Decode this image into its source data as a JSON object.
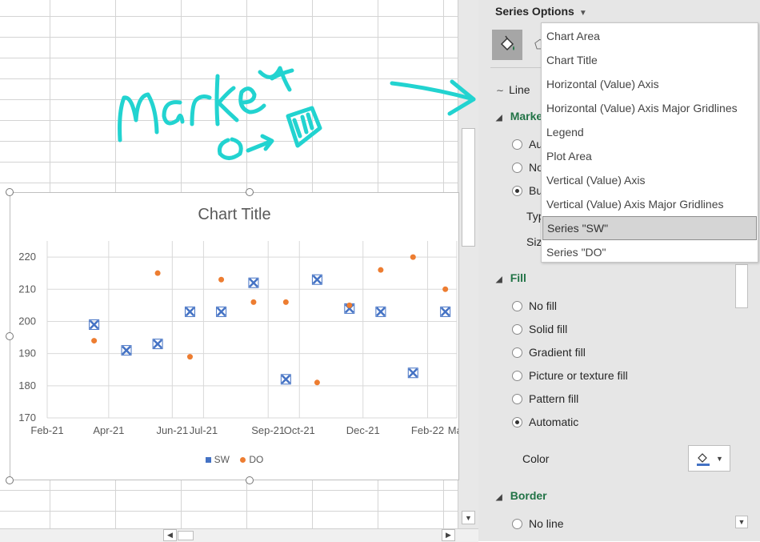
{
  "sheet": {},
  "chart": {
    "title": "Chart Title",
    "legend": [
      "SW",
      "DO"
    ]
  },
  "chart_data": {
    "type": "scatter",
    "title": "Chart Title",
    "x_tick_labels": [
      "Feb-21",
      "Apr-21",
      "Jun-21",
      "Jul-21",
      "Sep-21",
      "Oct-21",
      "Dec-21",
      "Feb-22",
      "Mar"
    ],
    "y_ticks": [
      170,
      180,
      190,
      200,
      210,
      220
    ],
    "ylim": [
      170,
      225
    ],
    "grid": true,
    "legend_position": "bottom",
    "series": [
      {
        "name": "SW",
        "marker": "cross-x",
        "color": "#4472c4",
        "points": [
          {
            "x": "2021-03-18",
            "y": 199
          },
          {
            "x": "2021-04-18",
            "y": 191
          },
          {
            "x": "2021-05-18",
            "y": 193
          },
          {
            "x": "2021-06-18",
            "y": 203
          },
          {
            "x": "2021-07-18",
            "y": 203
          },
          {
            "x": "2021-08-18",
            "y": 212
          },
          {
            "x": "2021-09-18",
            "y": 182
          },
          {
            "x": "2021-10-18",
            "y": 213
          },
          {
            "x": "2021-11-18",
            "y": 204
          },
          {
            "x": "2021-12-18",
            "y": 203
          },
          {
            "x": "2022-01-18",
            "y": 184
          },
          {
            "x": "2022-02-18",
            "y": 203
          }
        ]
      },
      {
        "name": "DO",
        "marker": "circle",
        "color": "#ed7d31",
        "points": [
          {
            "x": "2021-03-18",
            "y": 194
          },
          {
            "x": "2021-05-18",
            "y": 215
          },
          {
            "x": "2021-06-18",
            "y": 189
          },
          {
            "x": "2021-07-18",
            "y": 213
          },
          {
            "x": "2021-08-18",
            "y": 206
          },
          {
            "x": "2021-09-18",
            "y": 206
          },
          {
            "x": "2021-10-18",
            "y": 181
          },
          {
            "x": "2021-11-18",
            "y": 205
          },
          {
            "x": "2021-12-18",
            "y": 216
          },
          {
            "x": "2022-01-18",
            "y": 220
          },
          {
            "x": "2022-02-18",
            "y": 210
          }
        ]
      }
    ]
  },
  "pane": {
    "header": "Series Options",
    "line_label": "Line",
    "marker_section": "Marker",
    "marker_options": [
      "Automatic",
      "None",
      "Built-in"
    ],
    "type_label": "Type",
    "size_label": "Size",
    "fill_section": "Fill",
    "fill_options": [
      "No fill",
      "Solid fill",
      "Gradient fill",
      "Picture or texture fill",
      "Pattern fill",
      "Automatic"
    ],
    "fill_selected": "Automatic",
    "color_label": "Color",
    "border_section": "Border",
    "border_options": [
      "No line"
    ]
  },
  "dropdown": {
    "items": [
      "Chart Area",
      "Chart Title",
      "Horizontal (Value) Axis",
      "Horizontal (Value) Axis Major Gridlines",
      "Legend",
      "Plot Area",
      "Vertical (Value) Axis",
      "Vertical (Value) Axis Major Gridlines",
      "Series \"SW\"",
      "Series \"DO\""
    ],
    "selected": "Series \"SW\""
  },
  "annotation": {
    "text": "Marker",
    "color": "#22d3d0"
  },
  "colors": {
    "accent_green": "#217346",
    "sw": "#4472c4",
    "do": "#ed7d31"
  }
}
